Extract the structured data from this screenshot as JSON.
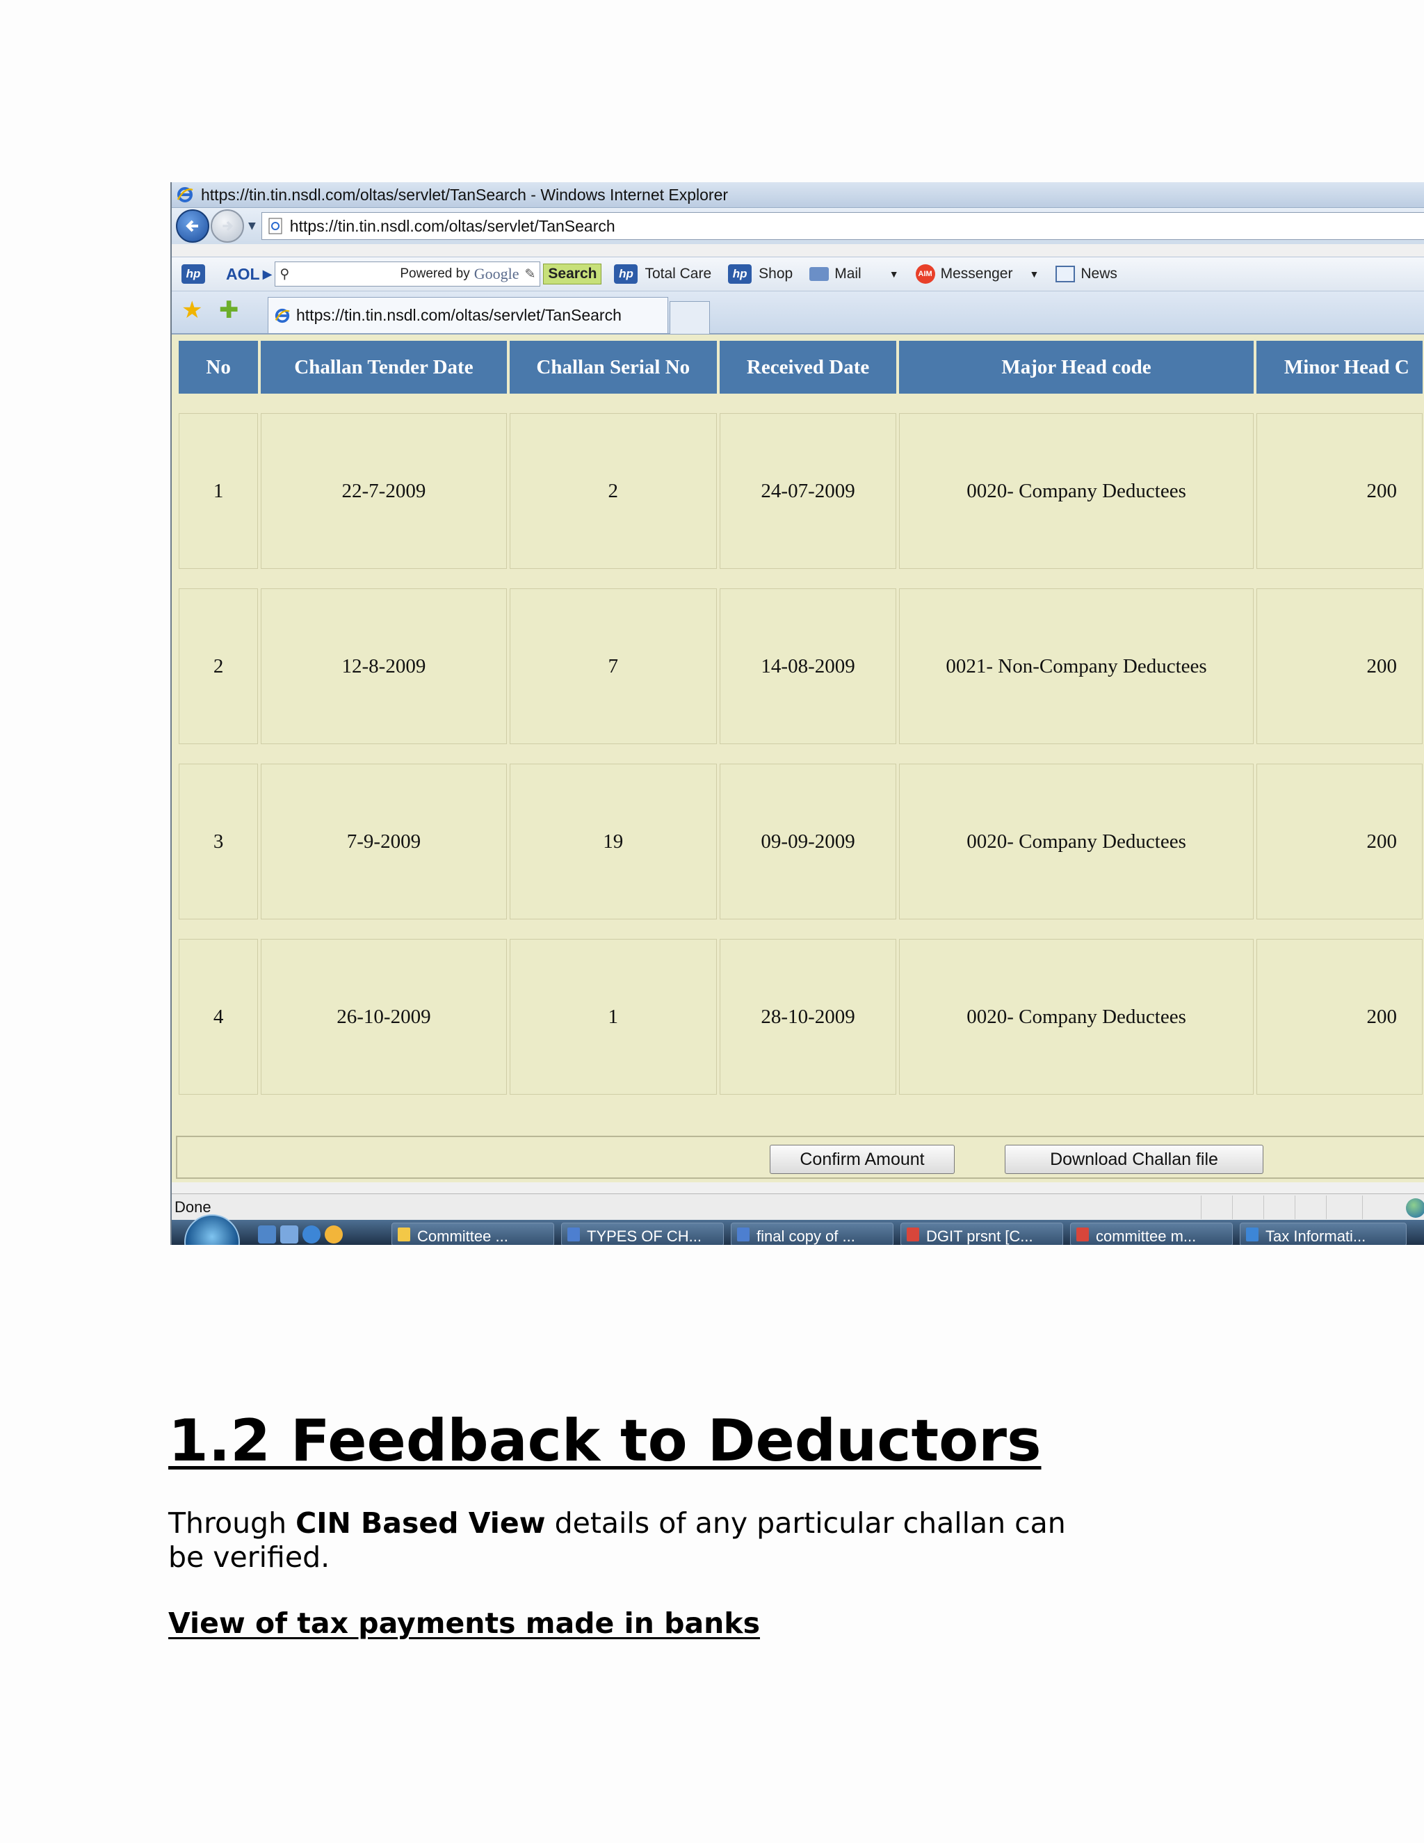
{
  "browser": {
    "window_title": "https://tin.tin.nsdl.com/oltas/servlet/TanSearch - Windows Internet Explorer",
    "address": "https://tin.tin.nsdl.com/oltas/servlet/TanSearch",
    "tab_title": "https://tin.tin.nsdl.com/oltas/servlet/TanSearch",
    "status": "Done"
  },
  "toolbar": {
    "hp_label": "hp",
    "aol_label": "AOL",
    "powered_by": "Powered by",
    "google": "Google",
    "search_label": "Search",
    "total_care_label": "Total Care",
    "shop_label": "Shop",
    "mail_label": "Mail",
    "messenger_label": "Messenger",
    "aim_label": "AIM",
    "news_label": "News"
  },
  "table": {
    "headers": [
      "No",
      "Challan Tender Date",
      "Challan Serial No",
      "Received Date",
      "Major Head code",
      "Minor Head C"
    ],
    "rows": [
      [
        "1",
        "22-7-2009",
        "2",
        "24-07-2009",
        "0020- Company Deductees",
        "200"
      ],
      [
        "2",
        "12-8-2009",
        "7",
        "14-08-2009",
        "0021- Non-Company Deductees",
        "200"
      ],
      [
        "3",
        "7-9-2009",
        "19",
        "09-09-2009",
        "0020- Company Deductees",
        "200"
      ],
      [
        "4",
        "26-10-2009",
        "1",
        "28-10-2009",
        "0020- Company Deductees",
        "200"
      ]
    ]
  },
  "buttons": {
    "confirm_amount": "Confirm Amount",
    "download_challan": "Download Challan file"
  },
  "taskbar": {
    "items": [
      "Committee ...",
      "TYPES OF CH...",
      "final copy of ...",
      "DGIT prsnt [C...",
      "committee m...",
      "Tax Informati..."
    ]
  },
  "document": {
    "heading": "1.2 Feedback to Deductors",
    "para_prefix": "Through ",
    "para_bold": "CIN Based View",
    "para_suffix": " details of any particular challan can be verified.",
    "subheading": "View of tax payments made in banks"
  }
}
